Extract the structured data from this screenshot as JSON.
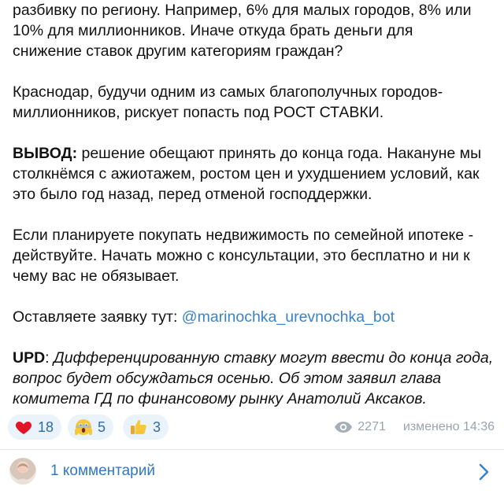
{
  "post": {
    "lines": [
      "разбивку по региону. Например, 6% для малых городов, 8% или",
      "10% для миллионников. Иначе откуда брать деньги для",
      "снижение ставок другим категориям граждан?",
      "Краснодар, будучи одним из самых благополучных городов-",
      "миллионников, рискует попасть под РОСТ СТАВКИ.",
      "ВЫВОД:",
      " решение обещают принять до конца года. Накануне мы",
      "столкнёмся с ажиотажем, ростом цен и ухудшением условий, как",
      "это было год назад, перед отменой господдержки.",
      "Если планируете покупать недвижимость по семейной ипотеке -",
      "действуйте. Начать можно с консультации, это бесплатно и ни к",
      "чему вас не обязывает.",
      "Оставляете заявку тут: ",
      "@marinochka_urevnochka_bot",
      "UPD",
      ": ",
      "Дифференцированную ставку могут ввести до конца года,",
      "вопрос будет обсуждаться осенью. Об этом заявил глава",
      "комитета ГД по финансовому рынку Анатолий Аксаков."
    ]
  },
  "reactions": [
    {
      "icon": "heart-icon",
      "count": "18"
    },
    {
      "icon": "scream-face-icon",
      "count": "5"
    },
    {
      "icon": "thumbs-up-icon",
      "count": "3"
    }
  ],
  "meta": {
    "views": "2271",
    "edited": "изменено 14:36"
  },
  "comments": {
    "label": "1 комментарий"
  },
  "colors": {
    "link": "#3a83c8",
    "reaction_bg": "#eaf2fa",
    "reaction_text": "#2f6ea5",
    "meta": "#9aa3ab"
  }
}
